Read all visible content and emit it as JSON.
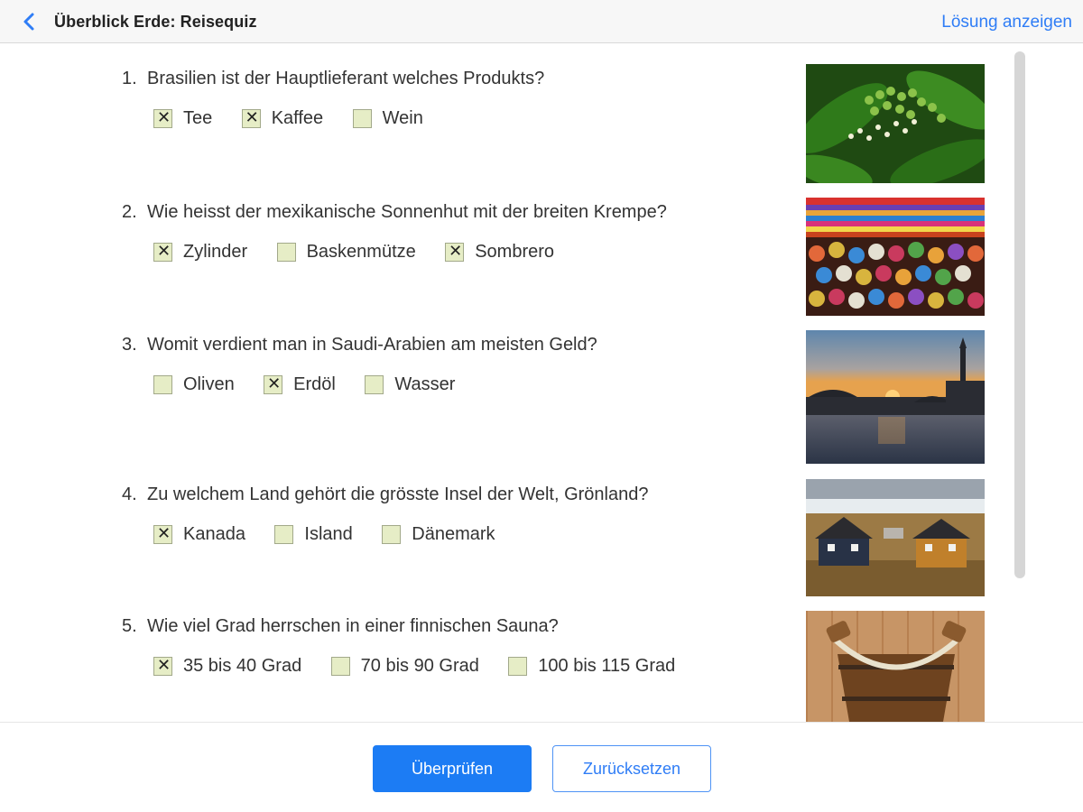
{
  "header": {
    "title": "Überblick Erde: Reisequiz",
    "solution_link": "Lösung anzeigen"
  },
  "questions": [
    {
      "number": "1.",
      "text": "Brasilien ist der Hauptlieferant welches Produkts?",
      "options": [
        {
          "label": "Tee",
          "checked": true
        },
        {
          "label": "Kaffee",
          "checked": true
        },
        {
          "label": "Wein",
          "checked": false
        }
      ]
    },
    {
      "number": "2.",
      "text": "Wie heisst der mexikanische Sonnenhut mit der breiten Krempe?",
      "options": [
        {
          "label": "Zylinder",
          "checked": true
        },
        {
          "label": "Baskenmütze",
          "checked": false
        },
        {
          "label": "Sombrero",
          "checked": true
        }
      ]
    },
    {
      "number": "3.",
      "text": "Womit verdient man in Saudi-Arabien am meisten Geld?",
      "options": [
        {
          "label": "Oliven",
          "checked": false
        },
        {
          "label": "Erdöl",
          "checked": true
        },
        {
          "label": "Wasser",
          "checked": false
        }
      ]
    },
    {
      "number": "4.",
      "text": "Zu welchem Land gehört die grösste Insel der Welt, Grönland?",
      "options": [
        {
          "label": "Kanada",
          "checked": true
        },
        {
          "label": "Island",
          "checked": false
        },
        {
          "label": "Dänemark",
          "checked": false
        }
      ]
    },
    {
      "number": "5.",
      "text": "Wie viel Grad herrschen in einer finnischen Sauna?",
      "options": [
        {
          "label": "35 bis 40 Grad",
          "checked": true
        },
        {
          "label": "70 bis 90 Grad",
          "checked": false
        },
        {
          "label": "100 bis 115 Grad",
          "checked": false
        }
      ]
    }
  ],
  "footer": {
    "check_label": "Überprüfen",
    "reset_label": "Zurücksetzen"
  },
  "colors": {
    "accent": "#1c7cf4",
    "checkbox_fill": "#e6edc6"
  }
}
